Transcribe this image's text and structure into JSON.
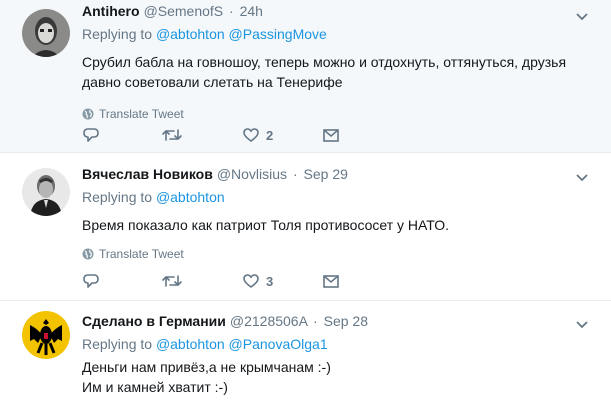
{
  "tweets": [
    {
      "name": "Antihero",
      "handle": "@SemenofS",
      "time": "24h",
      "replying_label": "Replying to",
      "mentions": [
        "@abtohton",
        "@PassingMove"
      ],
      "text": "Срубил бабла на говношоу, теперь можно и отдохнуть, оттянуться, друзья давно советовали слетать на Тенерифе",
      "translate": "Translate Tweet",
      "likes": "2"
    },
    {
      "name": "Вячеслав Новиков",
      "handle": "@Novlisius",
      "time": "Sep 29",
      "replying_label": "Replying to",
      "mentions": [
        "@abtohton"
      ],
      "text": "Время показало как патриот Толя противососет у НАТО.",
      "translate": "Translate Tweet",
      "likes": "3"
    },
    {
      "name": "Сделано в Германии",
      "handle": "@2128506A",
      "time": "Sep 28",
      "replying_label": "Replying to",
      "mentions": [
        "@abtohton",
        "@PanovaOlga1"
      ],
      "text_line1": "Деньги нам привёз,а не крымчанам :-)",
      "text_line2": "Им и камней хватит :-)"
    }
  ],
  "separator": "·",
  "icons": {
    "reply": "reply-icon",
    "retweet": "retweet-icon",
    "like": "heart-icon",
    "message": "envelope-icon",
    "more": "chevron-down-icon",
    "globe": "globe-icon"
  },
  "colors": {
    "link": "#1b95e0",
    "muted": "#657786",
    "highlight_bg": "#f5f8fa",
    "text": "#14171a"
  }
}
